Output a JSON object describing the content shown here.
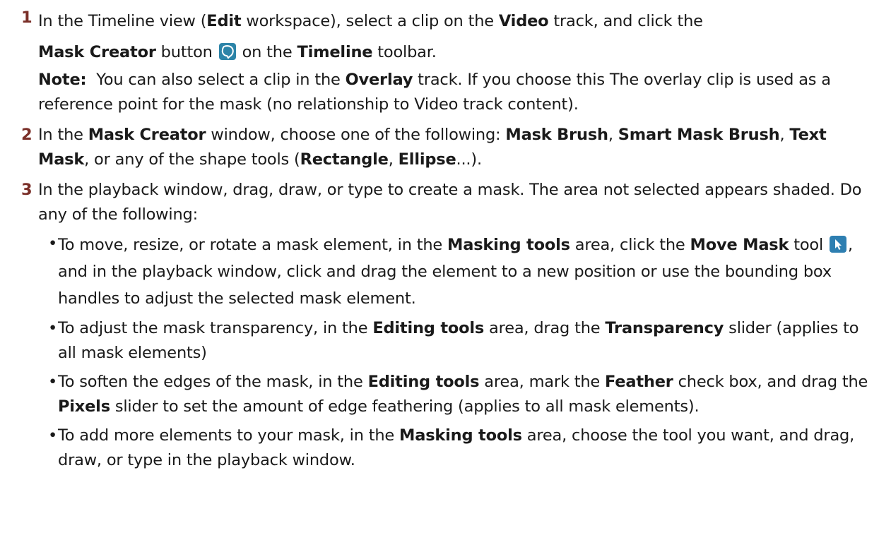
{
  "steps": [
    {
      "num": "1",
      "t1": "In the Timeline view (",
      "b1": "Edit",
      "t2": " workspace), select a clip on the ",
      "b2": "Video",
      "t3": " track, and click the",
      "b3": "Mask Creator",
      "t4": " button ",
      "icon": "mask-creator-icon",
      "t5": " on the ",
      "b4": "Timeline",
      "t6": " toolbar.",
      "note_label": "Note:",
      "note_t1": "  You can also select a clip in the ",
      "note_b1": "Overlay",
      "note_t2": " track. If you choose this The overlay clip is used as a reference point for the mask (no relationship to Video track content)."
    },
    {
      "num": "2",
      "t1": "In the ",
      "b1": "Mask Creator",
      "t2": " window, choose one of the following: ",
      "b2": "Mask Brush",
      "t3": ", ",
      "b3": "Smart Mask Brush",
      "t4": ", ",
      "b4": "Text Mask",
      "t5": ", or any of the shape tools (",
      "b5": "Rectangle",
      "t6": ", ",
      "b6": "Ellipse",
      "t7": "...)."
    },
    {
      "num": "3",
      "text": "In the playback window, drag, draw, or type to create a mask. The area not selected appears shaded. Do any of the following:"
    }
  ],
  "bullets": {
    "dot": "•",
    "b1": {
      "t1": "To move, resize, or rotate a mask element, in the ",
      "b1": "Masking tools",
      "t2": " area, click the ",
      "b2": "Move Mask",
      "t3": " tool ",
      "icon": "move-mask-icon",
      "t4": ", and in the playback window, click and drag the element to a new position or use the bounding box handles to adjust the selected mask element."
    },
    "b2": {
      "t1": "To adjust the mask transparency, in the ",
      "b1": "Editing tools",
      "t2": " area, drag the ",
      "b2": "Transparency",
      "t3": " slider (applies to all mask elements)"
    },
    "b3": {
      "t1": "To soften the edges of the mask, in the ",
      "b1": "Editing tools",
      "t2": " area, mark the ",
      "b2": "Feather",
      "t3": " check box, and drag the ",
      "b3": "Pixels",
      "t4": " slider to set the amount of edge feathering (applies to all mask elements)."
    },
    "b4": {
      "t1": "To add more elements to your mask, in the ",
      "b1": "Masking tools",
      "t2": " area, choose the tool you want, and drag, draw, or type in the playback window."
    }
  },
  "colors": {
    "step_number": "#7a2f28",
    "text": "#1a1a1a",
    "icon_bg": "#2c84a8"
  }
}
